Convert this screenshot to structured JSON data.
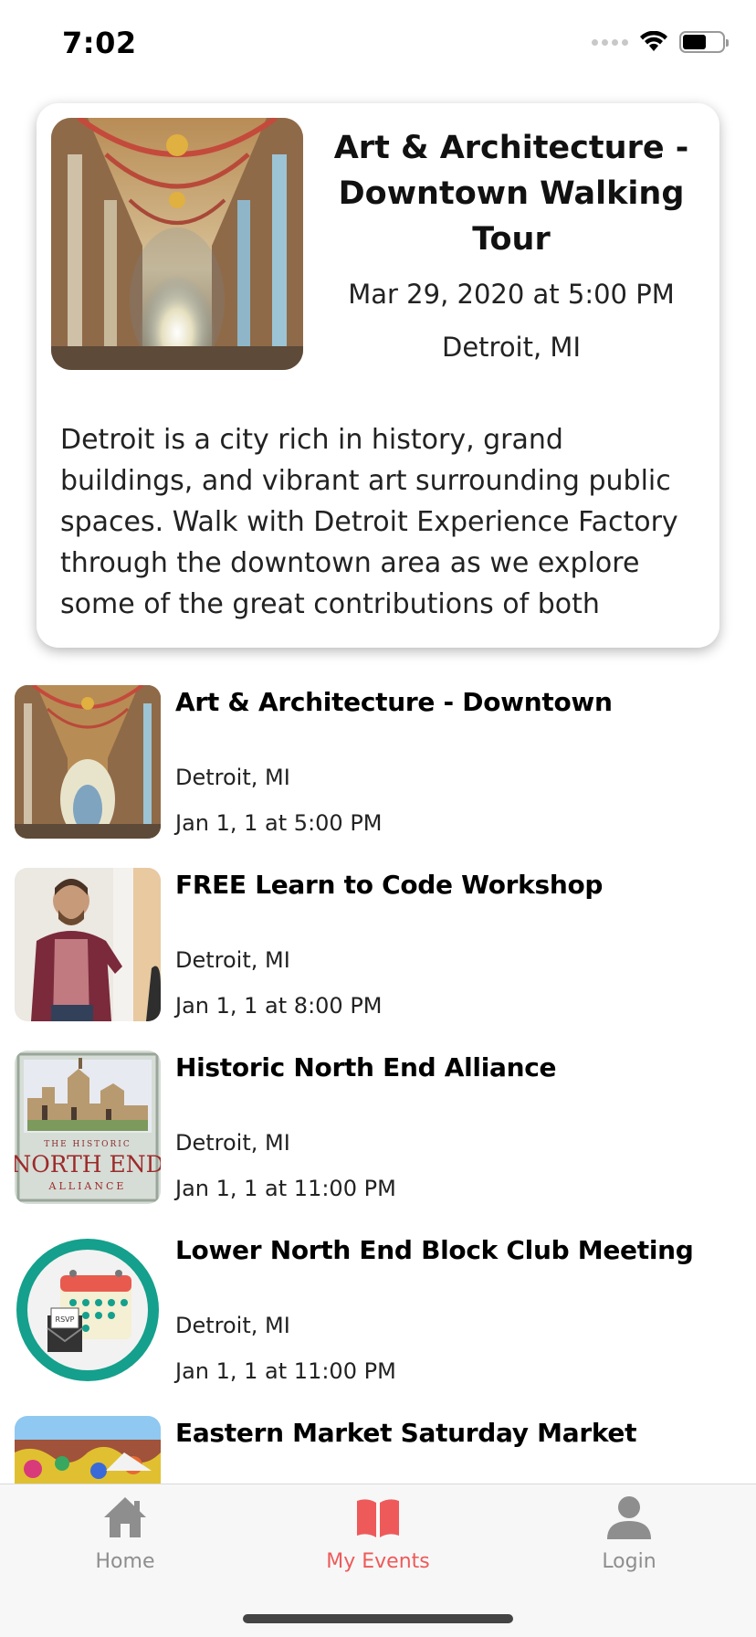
{
  "status_bar": {
    "time": "7:02"
  },
  "featured": {
    "title": "Art & Architecture - Downtown Walking Tour",
    "date": "Mar 29, 2020 at 5:00 PM",
    "location": "Detroit, MI",
    "description": "Detroit is a city rich in history, grand buildings, and vibrant art surrounding public spaces. Walk with Detroit Experience Factory through the downtown area as we explore some of the great contributions of both prolific architects"
  },
  "events": [
    {
      "title": "Art & Architecture - Downtown",
      "location": "Detroit, MI",
      "date": "Jan 1, 1 at 5:00 PM"
    },
    {
      "title": "FREE Learn to Code Workshop",
      "location": "Detroit, MI",
      "date": "Jan 1, 1 at 8:00 PM"
    },
    {
      "title": "Historic North End Alliance",
      "location": "Detroit, MI",
      "date": "Jan 1, 1 at 11:00 PM"
    },
    {
      "title": "Lower North End Block Club Meeting",
      "location": "Detroit, MI",
      "date": "Jan 1, 1 at 11:00 PM"
    },
    {
      "title": "Eastern Market Saturday Market",
      "location": "",
      "date": ""
    }
  ],
  "logo_text": {
    "north_end_top": "THE HISTORIC",
    "north_end_main": "NORTH END",
    "north_end_bottom": "ALLIANCE",
    "calendar_rsvp": "RSVP"
  },
  "tabs": [
    {
      "label": "Home",
      "icon": "home-icon",
      "active": false
    },
    {
      "label": "My Events",
      "icon": "book-icon",
      "active": true
    },
    {
      "label": "Login",
      "icon": "person-icon",
      "active": false
    }
  ],
  "colors": {
    "accent": "#ee5a5a",
    "inactive": "#8e8e8e",
    "teal": "#14a08c"
  }
}
